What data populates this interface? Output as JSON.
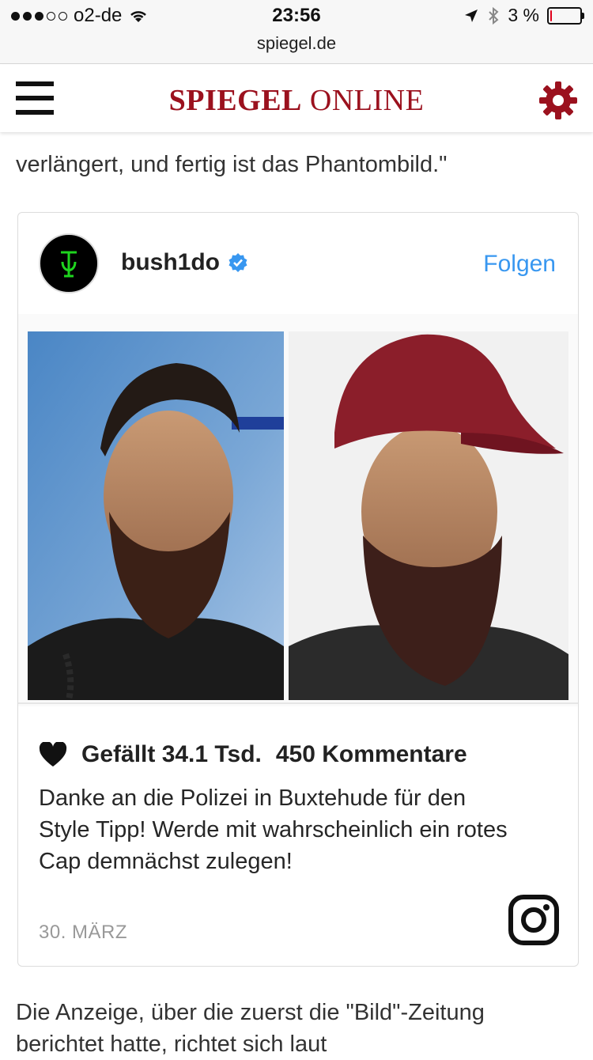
{
  "status": {
    "carrier": "o2-de",
    "signal_bars": 3,
    "time": "23:56",
    "url": "spiegel.de",
    "battery_text": "3 %",
    "battery_level": 0.03
  },
  "header": {
    "logo_bold": "SPIEGEL",
    "logo_regular": "ONLINE",
    "brand_color": "#9b111e"
  },
  "article": {
    "partial_line_above": "verlängert, und fertig ist das Phantombild.\"",
    "line_after_card_1": "Die Anzeige, über die zuerst die \"Bild\"-Zeitung",
    "line_after_card_2": "berichtet hatte, richtet sich laut"
  },
  "instagram": {
    "username": "bush1do",
    "verified": true,
    "follow_label": "Folgen",
    "likes_text": "Gefällt 34.1 Tsd.",
    "comments_text": "450 Kommentare",
    "caption": "Danke an die Polizei in Buxtehude für den Style Tipp! Werde mit wahrscheinlich ein rotes Cap demnächst zulegen!",
    "date": "30. MÄRZ",
    "accent_color": "#3897f0"
  },
  "icons": [
    "hamburger-menu-icon",
    "gear-icon",
    "location-arrow-icon",
    "bluetooth-icon",
    "wifi-icon",
    "verified-badge-icon",
    "heart-icon",
    "instagram-icon"
  ]
}
